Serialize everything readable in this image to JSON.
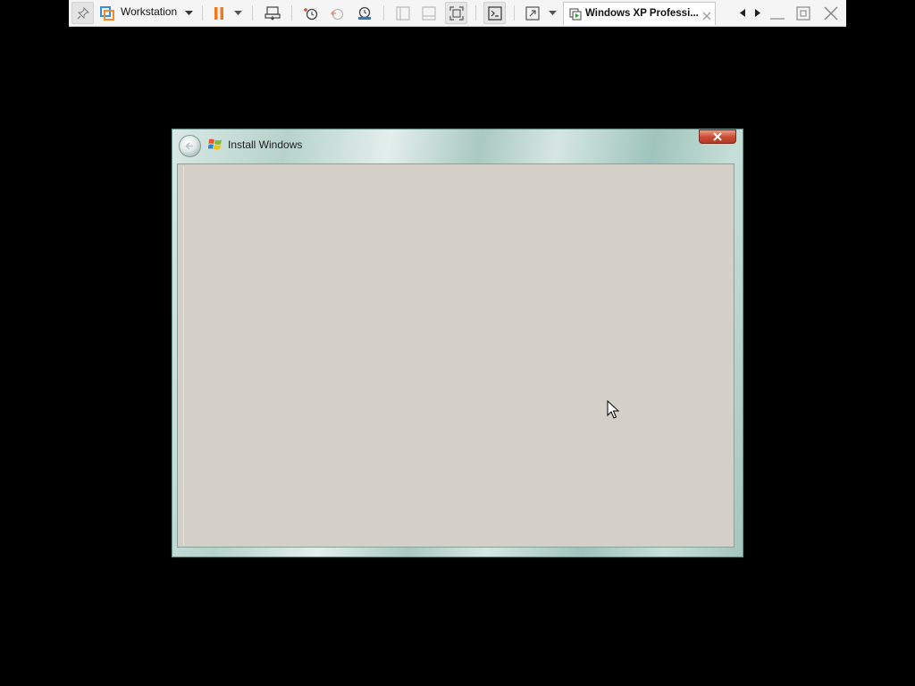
{
  "toolbar": {
    "library_label": "Workstation",
    "vm_tab_label": "Windows XP Professi..."
  },
  "icons": {
    "pin": "pin-icon",
    "workstation": "workstation-logo-icon",
    "library_dropdown": "chevron-down-icon",
    "pause": "pause-icon",
    "power_dropdown": "chevron-down-icon",
    "send_ctrl_alt_del": "send-keys-icon",
    "snapshot_take": "snapshot-icon",
    "snapshot_revert": "snapshot-revert-icon",
    "snapshot_manager": "snapshot-manager-icon",
    "show_library": "library-view-icon",
    "thumbnail_bar": "thumbnail-bar-icon",
    "fit_guest": "fit-guest-icon",
    "console_view": "console-view-icon",
    "full_screen": "full-screen-icon",
    "full_screen_dropdown": "chevron-down-icon",
    "vm_tab": "vm-tab-icon",
    "tab_close": "close-icon",
    "tab_scroll_left": "triangle-left-icon",
    "tab_scroll_right": "triangle-right-icon",
    "minimize": "minimize-icon",
    "restore": "restore-icon",
    "close": "close-icon"
  },
  "install_window": {
    "title": "Install Windows"
  },
  "colors": {
    "pause_accent": "#f07a22",
    "content_bg": "#d4d0c8",
    "close_red": "#c94a32",
    "aero_glass": "#b6d3cb"
  }
}
